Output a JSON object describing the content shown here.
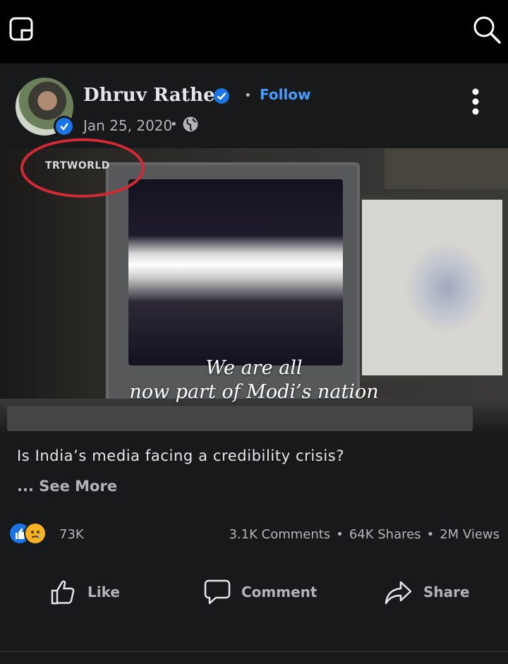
{
  "topbar": {
    "app_icon": "square-corner-icon",
    "search_icon": "search-icon"
  },
  "post": {
    "author": "Dhruv Rathee",
    "follow_label": "Follow",
    "date": "Jan 25, 2020",
    "privacy_icon": "globe-icon",
    "more_icon": "more-vertical-icon"
  },
  "media": {
    "logo_text": "TRTWORLD",
    "caption_line1": "We are all",
    "caption_line2": "now part of Modi’s nation"
  },
  "body": {
    "text": "Is India’s media facing a credibility crisis?",
    "see_more": "... See More"
  },
  "engagement": {
    "reaction_count": "73K",
    "comments": "3.1K Comments",
    "shares": "64K Shares",
    "views": "2M Views",
    "separator": "•"
  },
  "actions": {
    "like": "Like",
    "comment": "Comment",
    "share": "Share"
  },
  "colors": {
    "background": "#18191a",
    "accent": "#4a9bff",
    "verified": "#1b74e4",
    "highlight_circle": "#d02a36"
  }
}
